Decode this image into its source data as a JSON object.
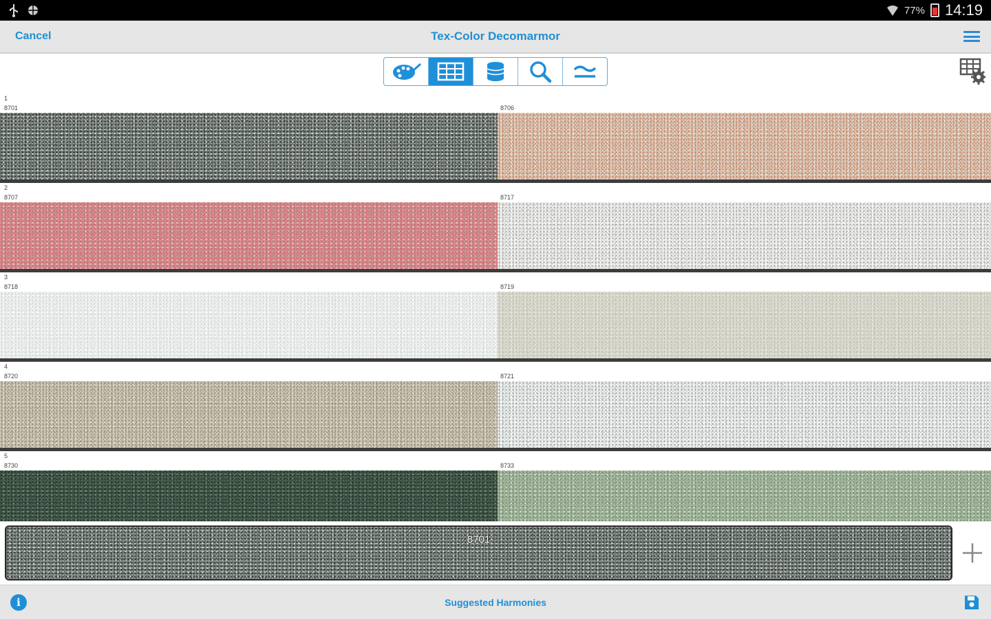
{
  "status_bar": {
    "battery": "77%",
    "time": "14:19"
  },
  "header": {
    "cancel_label": "Cancel",
    "title": "Tex-Color Decomarmor"
  },
  "icons": {
    "usb": "usb-icon",
    "android": "android-debug-icon",
    "wifi": "wifi-icon",
    "battery": "battery-icon",
    "menu": "hamburger-menu-icon",
    "palette": "palette-brush-icon",
    "grid": "grid-table-icon",
    "stack": "color-stack-icon",
    "search": "search-icon",
    "approx": "approximately-equal-icon",
    "settings": "grid-settings-icon",
    "add": "plus-icon",
    "info": "info-icon",
    "save": "save-floppy-icon"
  },
  "accent_color": "#1e8fd6",
  "rows": [
    {
      "index": "1",
      "swatches": [
        {
          "code": "8701",
          "base": "#6f7772",
          "c1": "#2b302d",
          "c2": "#dfe2dc",
          "c3": "#9aa39d"
        },
        {
          "code": "8706",
          "base": "#ddc8b8",
          "c1": "#c8835e",
          "c2": "#f1e8df",
          "c3": "#b99f8d"
        }
      ]
    },
    {
      "index": "2",
      "swatches": [
        {
          "code": "8707",
          "base": "#dc8a8c",
          "c1": "#c8696d",
          "c2": "#f3cdcc",
          "c3": "#a98a88"
        },
        {
          "code": "8717",
          "base": "#eeeeec",
          "c1": "#a5a5a3",
          "c2": "#ffffff",
          "c3": "#cfcfcc"
        }
      ]
    },
    {
      "index": "3",
      "swatches": [
        {
          "code": "8718",
          "base": "#eef1ef",
          "c1": "#cfd6d2",
          "c2": "#ffffff",
          "c3": "#dfe4e1"
        },
        {
          "code": "8719",
          "base": "#dcdbd0",
          "c1": "#bdbcb0",
          "c2": "#eceae1",
          "c3": "#cfcdc1"
        }
      ]
    },
    {
      "index": "4",
      "swatches": [
        {
          "code": "8720",
          "base": "#cfc7b5",
          "c1": "#8d8a7e",
          "c2": "#ebe3d2",
          "c3": "#a9a08c"
        },
        {
          "code": "8721",
          "base": "#ecefee",
          "c1": "#9da19f",
          "c2": "#ffffff",
          "c3": "#cdd2d0"
        }
      ]
    },
    {
      "index": "5",
      "swatches": [
        {
          "code": "8730",
          "base": "#3d5244",
          "c1": "#203028",
          "c2": "#7e907f",
          "c3": "#4f6657"
        },
        {
          "code": "8733",
          "base": "#a6b8a0",
          "c1": "#6f876d",
          "c2": "#dfe8d8",
          "c3": "#8fa68a"
        }
      ]
    }
  ],
  "selected": {
    "code": "8701",
    "base": "#6f7772",
    "c1": "#2b302d",
    "c2": "#dfe2dc",
    "c3": "#9aa39d"
  },
  "footer": {
    "harmonies_label": "Suggested Harmonies",
    "info_label": "i"
  }
}
